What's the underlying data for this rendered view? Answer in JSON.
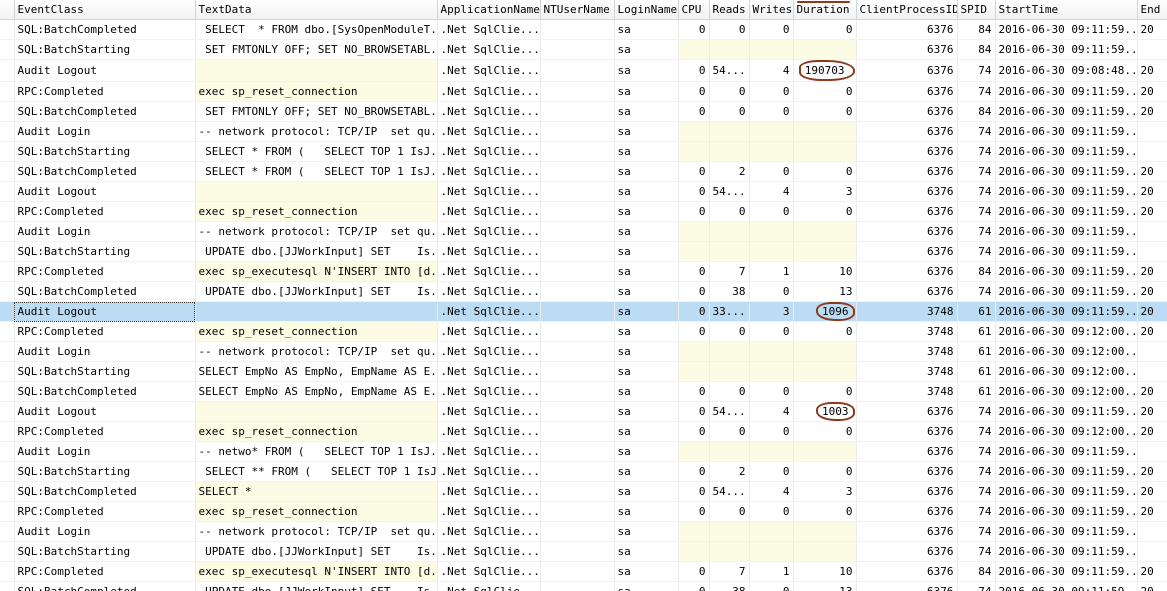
{
  "columns": [
    "EventClass",
    "TextData",
    "ApplicationName",
    "NTUserName",
    "LoginName",
    "CPU",
    "Reads",
    "Writes",
    "Duration",
    "ClientProcessID",
    "SPID",
    "StartTime",
    "End"
  ],
  "sorted_column": "Duration",
  "rows": [
    {
      "event": "SQL:BatchCompleted",
      "text": " SELECT  * FROM dbo.[SysOpenModuleT...",
      "app": ".Net SqlClie...",
      "nt": "",
      "login": "sa",
      "cpu": "0",
      "reads": "0",
      "writes": "0",
      "duration": "0",
      "pid": "6376",
      "spid": "84",
      "start": "2016-06-30 09:11:59...",
      "end": "20"
    },
    {
      "event": "SQL:BatchStarting",
      "text": " SET FMTONLY OFF; SET NO_BROWSETABL...",
      "app": ".Net SqlClie...",
      "nt": "",
      "login": "sa",
      "cpu": "",
      "reads": "",
      "writes": "",
      "duration": "",
      "pid": "6376",
      "spid": "84",
      "start": "2016-06-30 09:11:59...",
      "end": ""
    },
    {
      "event": "Audit Logout",
      "text": "",
      "app": ".Net SqlClie...",
      "nt": "",
      "login": "sa",
      "cpu": "0",
      "reads": "54...",
      "writes": "4",
      "duration": "190703",
      "pid": "6376",
      "spid": "74",
      "start": "2016-06-30 09:08:48...",
      "end": "20"
    },
    {
      "event": "RPC:Completed",
      "text": "exec sp_reset_connection",
      "app": ".Net SqlClie...",
      "nt": "",
      "login": "sa",
      "cpu": "0",
      "reads": "0",
      "writes": "0",
      "duration": "0",
      "pid": "6376",
      "spid": "74",
      "start": "2016-06-30 09:11:59...",
      "end": "20"
    },
    {
      "event": "SQL:BatchCompleted",
      "text": " SET FMTONLY OFF; SET NO_BROWSETABL...",
      "app": ".Net SqlClie...",
      "nt": "",
      "login": "sa",
      "cpu": "0",
      "reads": "0",
      "writes": "0",
      "duration": "0",
      "pid": "6376",
      "spid": "84",
      "start": "2016-06-30 09:11:59...",
      "end": "20"
    },
    {
      "event": "Audit Login",
      "text": "-- network protocol: TCP/IP  set qu...",
      "app": ".Net SqlClie...",
      "nt": "",
      "login": "sa",
      "cpu": "",
      "reads": "",
      "writes": "",
      "duration": "",
      "pid": "6376",
      "spid": "74",
      "start": "2016-06-30 09:11:59...",
      "end": ""
    },
    {
      "event": "SQL:BatchStarting",
      "text": " SELECT * FROM (   SELECT TOP 1 IsJ...",
      "app": ".Net SqlClie...",
      "nt": "",
      "login": "sa",
      "cpu": "",
      "reads": "",
      "writes": "",
      "duration": "",
      "pid": "6376",
      "spid": "74",
      "start": "2016-06-30 09:11:59...",
      "end": ""
    },
    {
      "event": "SQL:BatchCompleted",
      "text": " SELECT * FROM (   SELECT TOP 1 IsJ...",
      "app": ".Net SqlClie...",
      "nt": "",
      "login": "sa",
      "cpu": "0",
      "reads": "2",
      "writes": "0",
      "duration": "0",
      "pid": "6376",
      "spid": "74",
      "start": "2016-06-30 09:11:59...",
      "end": "20"
    },
    {
      "event": "Audit Logout",
      "text": "",
      "app": ".Net SqlClie...",
      "nt": "",
      "login": "sa",
      "cpu": "0",
      "reads": "54...",
      "writes": "4",
      "duration": "3",
      "pid": "6376",
      "spid": "74",
      "start": "2016-06-30 09:11:59...",
      "end": "20"
    },
    {
      "event": "RPC:Completed",
      "text": "exec sp_reset_connection",
      "app": ".Net SqlClie...",
      "nt": "",
      "login": "sa",
      "cpu": "0",
      "reads": "0",
      "writes": "0",
      "duration": "0",
      "pid": "6376",
      "spid": "74",
      "start": "2016-06-30 09:11:59...",
      "end": "20"
    },
    {
      "event": "Audit Login",
      "text": "-- network protocol: TCP/IP  set qu...",
      "app": ".Net SqlClie...",
      "nt": "",
      "login": "sa",
      "cpu": "",
      "reads": "",
      "writes": "",
      "duration": "",
      "pid": "6376",
      "spid": "74",
      "start": "2016-06-30 09:11:59...",
      "end": ""
    },
    {
      "event": "SQL:BatchStarting",
      "text": " UPDATE dbo.[JJWorkInput] SET    Is...",
      "app": ".Net SqlClie...",
      "nt": "",
      "login": "sa",
      "cpu": "",
      "reads": "",
      "writes": "",
      "duration": "",
      "pid": "6376",
      "spid": "74",
      "start": "2016-06-30 09:11:59...",
      "end": ""
    },
    {
      "event": "RPC:Completed",
      "text": "exec sp_executesql N'INSERT INTO [d...",
      "app": ".Net SqlClie...",
      "nt": "",
      "login": "sa",
      "cpu": "0",
      "reads": "7",
      "writes": "1",
      "duration": "10",
      "pid": "6376",
      "spid": "84",
      "start": "2016-06-30 09:11:59...",
      "end": "20"
    },
    {
      "event": "SQL:BatchCompleted",
      "text": " UPDATE dbo.[JJWorkInput] SET    Is...",
      "app": ".Net SqlClie...",
      "nt": "",
      "login": "sa",
      "cpu": "0",
      "reads": "38",
      "writes": "0",
      "duration": "13",
      "pid": "6376",
      "spid": "74",
      "start": "2016-06-30 09:11:59...",
      "end": "20"
    },
    {
      "event": "Audit Logout",
      "text": "",
      "app": ".Net SqlClie...",
      "nt": "",
      "login": "sa",
      "cpu": "0",
      "reads": "33...",
      "writes": "3",
      "duration": "1096",
      "pid": "3748",
      "spid": "61",
      "start": "2016-06-30 09:11:59...",
      "end": "20"
    },
    {
      "event": "RPC:Completed",
      "text": "exec sp_reset_connection",
      "app": ".Net SqlClie...",
      "nt": "",
      "login": "sa",
      "cpu": "0",
      "reads": "0",
      "writes": "0",
      "duration": "0",
      "pid": "3748",
      "spid": "61",
      "start": "2016-06-30 09:12:00...",
      "end": "20"
    },
    {
      "event": "Audit Login",
      "text": "-- network protocol: TCP/IP  set qu...",
      "app": ".Net SqlClie...",
      "nt": "",
      "login": "sa",
      "cpu": "",
      "reads": "",
      "writes": "",
      "duration": "",
      "pid": "3748",
      "spid": "61",
      "start": "2016-06-30 09:12:00...",
      "end": ""
    },
    {
      "event": "SQL:BatchStarting",
      "text": "SELECT EmpNo AS EmpNo, EmpName AS E...",
      "app": ".Net SqlClie...",
      "nt": "",
      "login": "sa",
      "cpu": "",
      "reads": "",
      "writes": "",
      "duration": "",
      "pid": "3748",
      "spid": "61",
      "start": "2016-06-30 09:12:00...",
      "end": ""
    },
    {
      "event": "SQL:BatchCompleted",
      "text": "SELECT EmpNo AS EmpNo, EmpName AS E...",
      "app": ".Net SqlClie...",
      "nt": "",
      "login": "sa",
      "cpu": "0",
      "reads": "0",
      "writes": "0",
      "duration": "0",
      "pid": "3748",
      "spid": "61",
      "start": "2016-06-30 09:12:00...",
      "end": "20"
    },
    {
      "event": "Audit Logout",
      "text": "",
      "app": ".Net SqlClie...",
      "nt": "",
      "login": "sa",
      "cpu": "0",
      "reads": "54...",
      "writes": "4",
      "duration": "1003",
      "pid": "6376",
      "spid": "74",
      "start": "2016-06-30 09:11:59...",
      "end": "20"
    },
    {
      "event": "RPC:Completed",
      "text": "exec sp_reset_connection",
      "app": ".Net SqlClie...",
      "nt": "",
      "login": "sa",
      "cpu": "0",
      "reads": "0",
      "writes": "0",
      "duration": "0",
      "pid": "6376",
      "spid": "74",
      "start": "2016-06-30 09:12:00...",
      "end": "20"
    },
    {
      "event": "Audit Login",
      "text": "-- netwo* FROM (   SELECT TOP 1 IsJ...",
      "app": ".Net SqlClie...",
      "nt": "",
      "login": "sa",
      "cpu": "",
      "reads": "",
      "writes": "",
      "duration": "",
      "pid": "6376",
      "spid": "74",
      "start": "2016-06-30 09:11:59...",
      "end": ""
    },
    {
      "event": "SQL:BatchStarting",
      "text": " SELECT ** FROM (   SELECT TOP 1 IsJ...",
      "app": ".Net SqlClie...",
      "nt": "",
      "login": "sa",
      "cpu": "0",
      "reads": "2",
      "writes": "0",
      "duration": "0",
      "pid": "6376",
      "spid": "74",
      "start": "2016-06-30 09:11:59...",
      "end": "20"
    },
    {
      "event": "SQL:BatchCompleted",
      "text": "SELECT *",
      "app": ".Net SqlClie...",
      "nt": "",
      "login": "sa",
      "cpu": "0",
      "reads": "54...",
      "writes": "4",
      "duration": "3",
      "pid": "6376",
      "spid": "74",
      "start": "2016-06-30 09:11:59...",
      "end": "20"
    },
    {
      "event": "RPC:Completed",
      "text": "exec sp_reset_connection",
      "app": ".Net SqlClie...",
      "nt": "",
      "login": "sa",
      "cpu": "0",
      "reads": "0",
      "writes": "0",
      "duration": "0",
      "pid": "6376",
      "spid": "74",
      "start": "2016-06-30 09:11:59...",
      "end": "20"
    },
    {
      "event": "Audit Login",
      "text": "-- network protocol: TCP/IP  set qu...",
      "app": ".Net SqlClie...",
      "nt": "",
      "login": "sa",
      "cpu": "",
      "reads": "",
      "writes": "",
      "duration": "",
      "pid": "6376",
      "spid": "74",
      "start": "2016-06-30 09:11:59...",
      "end": ""
    },
    {
      "event": "SQL:BatchStarting",
      "text": " UPDATE dbo.[JJWorkInput] SET    Is...",
      "app": ".Net SqlClie...",
      "nt": "",
      "login": "sa",
      "cpu": "",
      "reads": "",
      "writes": "",
      "duration": "",
      "pid": "6376",
      "spid": "74",
      "start": "2016-06-30 09:11:59...",
      "end": ""
    },
    {
      "event": "RPC:Completed",
      "text": "exec sp_executesql N'INSERT INTO [d...",
      "app": ".Net SqlClie...",
      "nt": "",
      "login": "sa",
      "cpu": "0",
      "reads": "7",
      "writes": "1",
      "duration": "10",
      "pid": "6376",
      "spid": "84",
      "start": "2016-06-30 09:11:59...",
      "end": "20"
    },
    {
      "event": "SQL:BatchCompleted",
      "text": " UPDATE dbo.[JJWorkInput] SET    Is...",
      "app": ".Net SqlClie...",
      "nt": "",
      "login": "sa",
      "cpu": "0",
      "reads": "38",
      "writes": "0",
      "duration": "13",
      "pid": "6376",
      "spid": "74",
      "start": "2016-06-30 09:11:59...",
      "end": "20"
    }
  ],
  "selected_row": 14,
  "circled_rows": [
    2,
    14,
    19
  ],
  "colors": {
    "selection": "#bcdcf4",
    "text_highlight": "#fcfbe3",
    "annotation": "#8b3a1e"
  }
}
